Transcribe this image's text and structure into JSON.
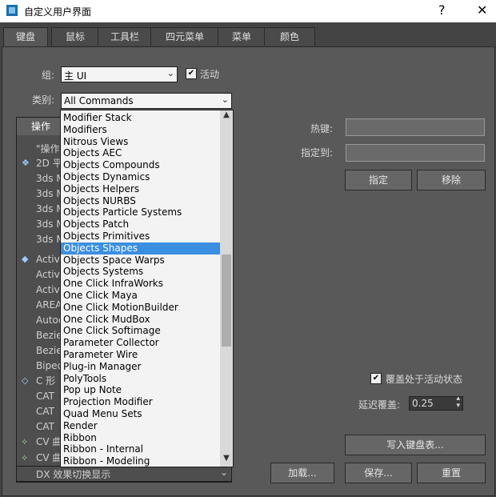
{
  "window": {
    "title": "自定义用户界面",
    "help": "?",
    "close": "✕"
  },
  "tabs": [
    "键盘",
    "鼠标",
    "工具栏",
    "四元菜单",
    "菜单",
    "颜色"
  ],
  "group": {
    "label": "组:",
    "value": "主 UI",
    "active_label": "活动",
    "active_checked": "✔"
  },
  "category": {
    "label": "类别:",
    "value": "All Commands"
  },
  "tree": {
    "header": "操作",
    "rows": [
      "\"操作",
      "2D 平",
      "3ds M",
      "3ds M",
      "3ds M",
      "3ds M",
      "3ds M",
      "Active",
      "Active",
      "Active",
      "AREA",
      "Autod",
      "Bezie",
      "Bezie",
      "Biped",
      "C 形",
      "CAT",
      "CAT",
      "CAT",
      "CV 曲",
      "CV 曲",
      "DX 效果切换显示"
    ]
  },
  "dropdown": {
    "items": [
      "Modifier Stack",
      "Modifiers",
      "Nitrous Views",
      "Objects AEC",
      "Objects Compounds",
      "Objects Dynamics",
      "Objects Helpers",
      "Objects NURBS",
      "Objects Particle Systems",
      "Objects Patch",
      "Objects Primitives",
      "Objects Shapes",
      "Objects Space Warps",
      "Objects Systems",
      "One Click InfraWorks",
      "One Click Maya",
      "One Click MotionBuilder",
      "One Click MudBox",
      "One Click Softimage",
      "Parameter Collector",
      "Parameter Wire",
      "Plug-in Manager",
      "PolyTools",
      "Pop up Note",
      "Projection Modifier",
      "Quad Menu Sets",
      "Render",
      "Ribbon",
      "Ribbon - Internal",
      "Ribbon - Modeling"
    ],
    "selected_index": 11
  },
  "hotkey": {
    "label": "热键:",
    "assigned_label": "指定到:",
    "assign_btn": "指定",
    "remove_btn": "移除"
  },
  "override": {
    "label": "覆盖处于活动状态",
    "checked": "✔",
    "delay_label": "延迟覆盖:",
    "delay_value": "0.25"
  },
  "buttons": {
    "write": "写入键盘表...",
    "load": "加载...",
    "save": "保存...",
    "reset": "重置"
  },
  "icons": {
    "chevron": "⌄",
    "up": "▲",
    "down": "▼",
    "spin_up": "▴",
    "spin_down": "▾"
  }
}
